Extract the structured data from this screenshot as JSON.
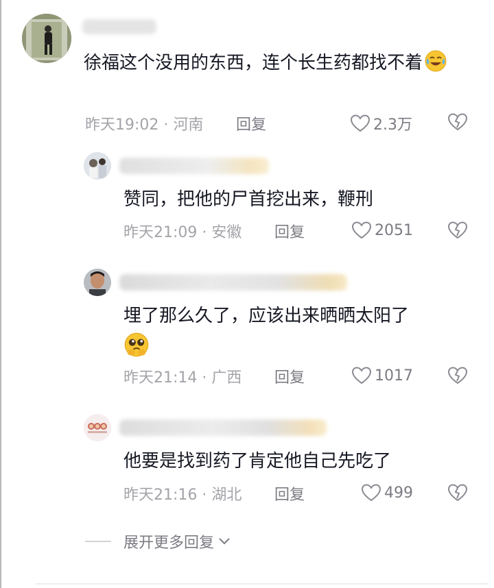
{
  "comments": [
    {
      "text": "徐福这个没用的东西，连个长生药都找不着",
      "time_location": "昨天19:02 · 河南",
      "reply_label": "回复",
      "likes": "2.3万"
    },
    {
      "text": "赞同，把他的尸首挖出来，鞭刑",
      "time_location": "昨天21:09 · 安徽",
      "reply_label": "回复",
      "likes": "2051"
    },
    {
      "text": "埋了那么久了，应该出来晒晒太阳了",
      "time_location": "昨天21:14 · 广西",
      "reply_label": "回复",
      "likes": "1017"
    },
    {
      "text": "他要是找到药了肯定他自己先吃了",
      "time_location": "昨天21:16 · 湖北",
      "reply_label": "回复",
      "likes": "499"
    }
  ],
  "expand_label": "展开更多回复",
  "colors": {
    "text": "#161823",
    "meta": "#a3a3a9",
    "action": "#7b7b83"
  },
  "icons": [
    "heart-icon",
    "dislike-heart-icon",
    "crying-laughing-emoji",
    "pleading-emoji",
    "chevron-down-icon"
  ]
}
